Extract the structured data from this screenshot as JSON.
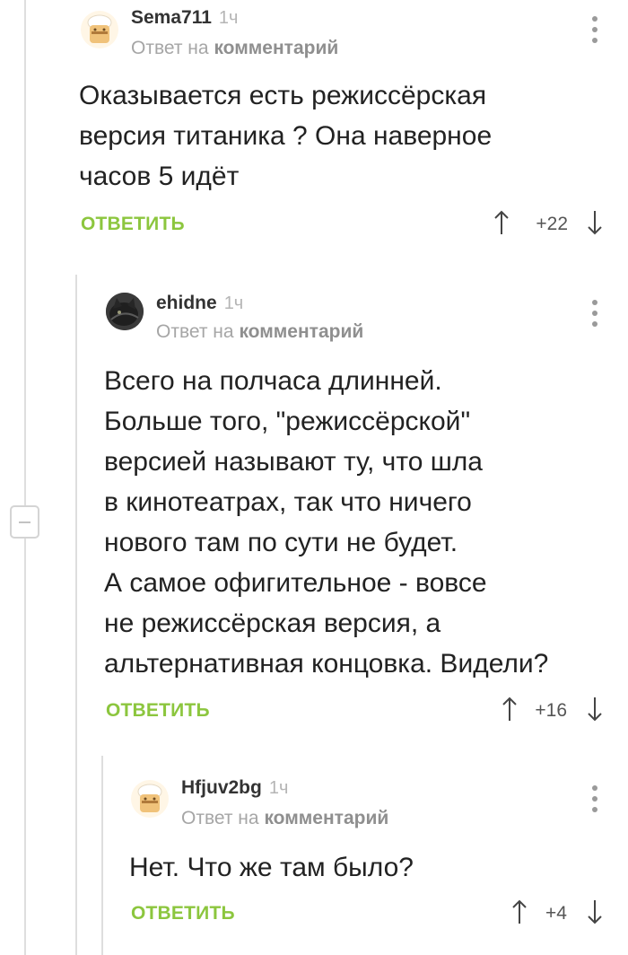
{
  "comments": [
    {
      "author": "Sema711",
      "time": "1ч",
      "reply_prefix": "Ответ на",
      "reply_target": "комментарий",
      "text": "Оказывается есть режиссёрская\nверсия титаника ? Она наверное\nчасов 5 идёт",
      "reply_label": "ОТВЕТИТЬ",
      "score": "+22",
      "avatar_icon": "chef-avatar-icon"
    },
    {
      "author": "ehidne",
      "time": "1ч",
      "reply_prefix": "Ответ на",
      "reply_target": "комментарий",
      "text": "Всего на полчаса длинней.\nБольше того, \"режиссёрской\"\nверсией называют ту, что шла\nв кинотеатрах, так что ничего\nнового там по сути не будет.\nА самое офигительное - вовсе\nне режиссёрская версия, а\nальтернативная концовка. Видели?",
      "reply_label": "ОТВЕТИТЬ",
      "score": "+16",
      "avatar_icon": "cat-avatar-icon"
    },
    {
      "author": "Hfjuv2bg",
      "time": "1ч",
      "reply_prefix": "Ответ на",
      "reply_target": "комментарий",
      "text": "Нет. Что же там было?",
      "reply_label": "ОТВЕТИТЬ",
      "score": "+4",
      "avatar_icon": "chef-avatar-icon"
    }
  ],
  "colors": {
    "accent_green": "#8cc63e",
    "thread_line": "#dedede",
    "meta_gray": "#a6a6a6"
  }
}
